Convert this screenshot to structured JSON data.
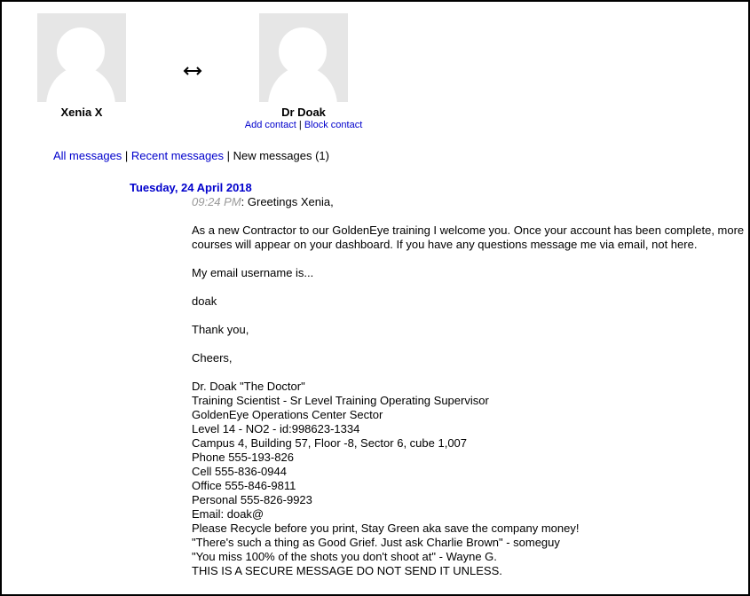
{
  "users": {
    "left": {
      "name": "Xenia X"
    },
    "right": {
      "name": "Dr Doak",
      "add_contact": "Add contact",
      "separator": "|",
      "block_contact": "Block contact"
    }
  },
  "filters": {
    "all": "All messages",
    "sep1": " | ",
    "recent": "Recent messages",
    "sep2": " | ",
    "new": "New messages (1)"
  },
  "conversation": {
    "date": "Tuesday, 24 April 2018",
    "time": "09:24 PM",
    "lines": [
      ": Greetings Xenia,",
      "",
      "As a new Contractor to our GoldenEye training I welcome you. Once your account has been complete, more courses will appear on your dashboard. If you have any questions message me via email, not here.",
      "",
      "My email username is...",
      "",
      "doak",
      "",
      "Thank you,",
      "",
      "Cheers,",
      "",
      "Dr. Doak \"The Doctor\"",
      "Training Scientist - Sr Level Training Operating Supervisor",
      "GoldenEye Operations Center Sector",
      "Level 14 - NO2 - id:998623-1334",
      "Campus 4, Building 57, Floor -8, Sector 6, cube 1,007",
      "Phone 555-193-826",
      "Cell 555-836-0944",
      "Office 555-846-9811",
      "Personal 555-826-9923",
      "Email: doak@",
      "Please Recycle before you print, Stay Green aka save the company money!",
      "\"There's such a thing as Good Grief. Just ask Charlie Brown\" - someguy",
      "\"You miss 100% of the shots you don't shoot at\" - Wayne G.",
      "THIS IS A SECURE MESSAGE DO NOT SEND IT UNLESS."
    ]
  }
}
